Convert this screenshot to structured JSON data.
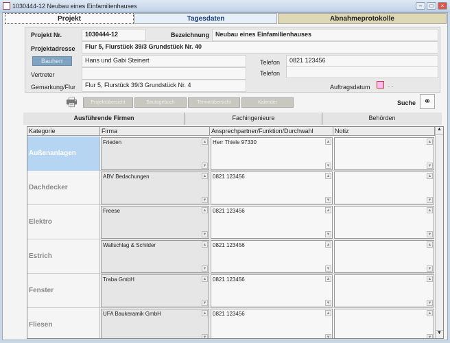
{
  "window": {
    "title": "1030444-12 Neubau eines Einfamilienhauses"
  },
  "main_tabs": [
    {
      "label": "Projekt"
    },
    {
      "label": "Tagesdaten"
    },
    {
      "label": "Abnahmeprotokolle"
    }
  ],
  "form": {
    "projekt_nr_label": "Projekt Nr.",
    "projekt_nr": "1030444-12",
    "bezeichnung_label": "Bezeichnung",
    "bezeichnung": "Neubau eines Einfamilienhauses",
    "projektadresse_label": "Projektadresse",
    "projektadresse": "Flur 5, Flurstück 39/3  Grundstück Nr. 40",
    "bauherr_button": "Bauherr",
    "bauherr": "Hans und Gabi Steinert",
    "telefon_label": "Telefon",
    "telefon1": "0821 123456",
    "telefon2": "",
    "vertreter_label": "Vertreter",
    "vertreter": "",
    "gemarkung_label": "Gemarkung/Flur",
    "gemarkung": "Flur 5, Flurstück 39/3  Grundstück Nr. 4",
    "auftragsdatum_label": "Auftragsdatum",
    "auftragsdatum": "- -"
  },
  "toolbar": {
    "buttons": [
      "Projektübersicht",
      "Bautagebuch",
      "Terminübersicht",
      "Kalender"
    ],
    "search_label": "Suche"
  },
  "sub_tabs": [
    {
      "label": "Ausführende Firmen"
    },
    {
      "label": "Fachingenieure"
    },
    {
      "label": "Behörden"
    }
  ],
  "table": {
    "columns": [
      "Kategorie",
      "Firma",
      "Ansprechpartner/Funktion/Durchwahl",
      "Notiz"
    ],
    "rows": [
      {
        "kategorie": "Außenanlagen",
        "firma": "Frieden",
        "kontakt": "Herr Thiele  97330",
        "notiz": ""
      },
      {
        "kategorie": "Dachdecker",
        "firma": "ABV Bedachungen",
        "kontakt": "0821 123456",
        "notiz": ""
      },
      {
        "kategorie": "Elektro",
        "firma": "Freese",
        "kontakt": "0821 123456",
        "notiz": ""
      },
      {
        "kategorie": "Estrich",
        "firma": "Wallschlag & Schilder",
        "kontakt": "0821 123456",
        "notiz": ""
      },
      {
        "kategorie": "Fenster",
        "firma": "Traba GmbH",
        "kontakt": "0821 123456",
        "notiz": ""
      },
      {
        "kategorie": "Fliesen",
        "firma": "UFA Baukeramik GmbH",
        "kontakt": "0821 123456",
        "notiz": ""
      }
    ]
  },
  "colors": {
    "selected_row": "#b5d5f2",
    "tagesdaten_tab": "#e6f0f8",
    "abnahme_tab": "#ded9b4",
    "title_accent": "#1a3a7a"
  }
}
